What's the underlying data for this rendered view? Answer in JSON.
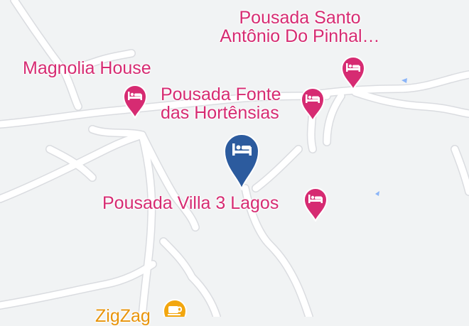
{
  "map": {
    "colors": {
      "background": "#f1f3f4",
      "road": "#ffffff",
      "road_outline": "#dadce0",
      "hotel_marker": "#d62b72",
      "selected_marker": "#2c5b9e",
      "food_marker": "#f2a60f",
      "water": "#8ab4f8"
    },
    "markers": [
      {
        "name": "Pousada Santo Antônio Do Pinhal…",
        "icon": "bed-icon",
        "type": "lodging"
      },
      {
        "name": "Magnolia House",
        "icon": "bed-icon",
        "type": "lodging"
      },
      {
        "name": "Pousada Fonte das Hortênsias",
        "icon": "bed-icon",
        "type": "lodging"
      },
      {
        "name": "",
        "icon": "bed-icon",
        "type": "selected-lodging"
      },
      {
        "name": "Pousada Villa 3 Lagos",
        "icon": "bed-icon",
        "type": "lodging"
      },
      {
        "name": "ZigZag",
        "icon": "coffee-cup-icon",
        "type": "food"
      }
    ],
    "labels": {
      "santo_antonio_line1": "Pousada Santo",
      "santo_antonio_line2": "Antônio Do Pinhal…",
      "magnolia": "Magnolia House",
      "fonte_line1": "Pousada Fonte",
      "fonte_line2": "das Hortênsias",
      "villa": "Pousada Villa 3 Lagos",
      "zigzag": "ZigZag"
    }
  }
}
